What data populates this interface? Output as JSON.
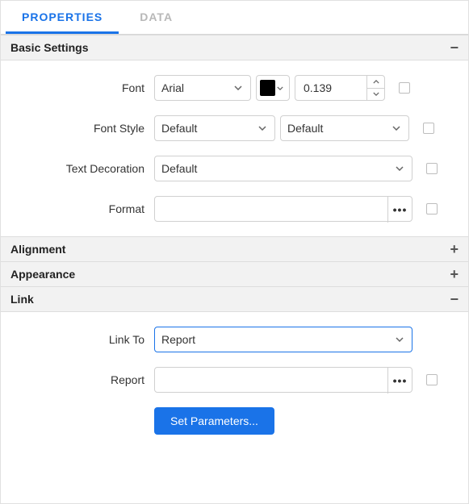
{
  "tabs": {
    "properties": "PROPERTIES",
    "data": "DATA"
  },
  "sections": {
    "basic": {
      "title": "Basic Settings"
    },
    "alignment": {
      "title": "Alignment"
    },
    "appearance": {
      "title": "Appearance"
    },
    "link": {
      "title": "Link"
    }
  },
  "labels": {
    "font": "Font",
    "fontStyle": "Font Style",
    "textDecoration": "Text Decoration",
    "format": "Format",
    "linkTo": "Link To",
    "report": "Report"
  },
  "values": {
    "fontFamily": "Arial",
    "fontColor": "#000000",
    "fontSize": "0.139",
    "fontStyle1": "Default",
    "fontStyle2": "Default",
    "textDecoration": "Default",
    "format": "",
    "linkTo": "Report",
    "report": ""
  },
  "buttons": {
    "setParameters": "Set Parameters..."
  }
}
